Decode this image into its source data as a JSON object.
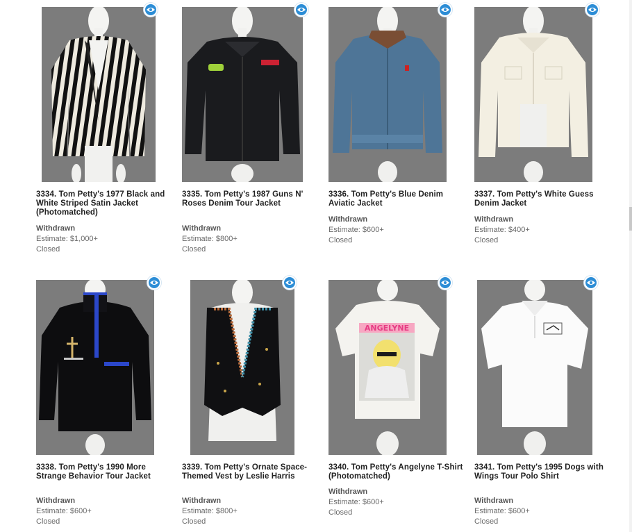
{
  "lots": [
    {
      "title": "3334. Tom Petty's 1977 Black and White Striped Satin Jacket (Photomatched)",
      "status": "Withdrawn",
      "estimate": "Estimate: $1,000+",
      "state": "Closed",
      "icon": "eye-icon"
    },
    {
      "title": "3335. Tom Petty's 1987 Guns N' Roses Denim Tour Jacket",
      "status": "Withdrawn",
      "estimate": "Estimate: $800+",
      "state": "Closed",
      "icon": "eye-icon"
    },
    {
      "title": "3336. Tom Petty's Blue Denim Aviatic Jacket",
      "status": "Withdrawn",
      "estimate": "Estimate: $600+",
      "state": "Closed",
      "icon": "eye-icon"
    },
    {
      "title": "3337. Tom Petty's White Guess Denim Jacket",
      "status": "Withdrawn",
      "estimate": "Estimate: $400+",
      "state": "Closed",
      "icon": "eye-icon"
    },
    {
      "title": "3338. Tom Petty's 1990 More Strange Behavior Tour Jacket",
      "status": "Withdrawn",
      "estimate": "Estimate: $600+",
      "state": "Closed",
      "icon": "eye-icon"
    },
    {
      "title": "3339. Tom Petty's Ornate Space-Themed Vest by Leslie Harris",
      "status": "Withdrawn",
      "estimate": "Estimate: $800+",
      "state": "Closed",
      "icon": "eye-icon"
    },
    {
      "title": "3340. Tom Petty's Angelyne T-Shirt (Photomatched)",
      "status": "Withdrawn",
      "estimate": "Estimate: $600+",
      "state": "Closed",
      "icon": "eye-icon",
      "print_text": "ANGELYNE"
    },
    {
      "title": "3341. Tom Petty's 1995 Dogs with Wings Tour Polo Shirt",
      "status": "Withdrawn",
      "estimate": "Estimate: $600+",
      "state": "Closed",
      "icon": "eye-icon"
    }
  ],
  "colors": {
    "photo_bg": "#7c7c7c",
    "icon_blue": "#2c8dd6",
    "title_text": "#222222",
    "meta_text": "#6a6a6a"
  }
}
